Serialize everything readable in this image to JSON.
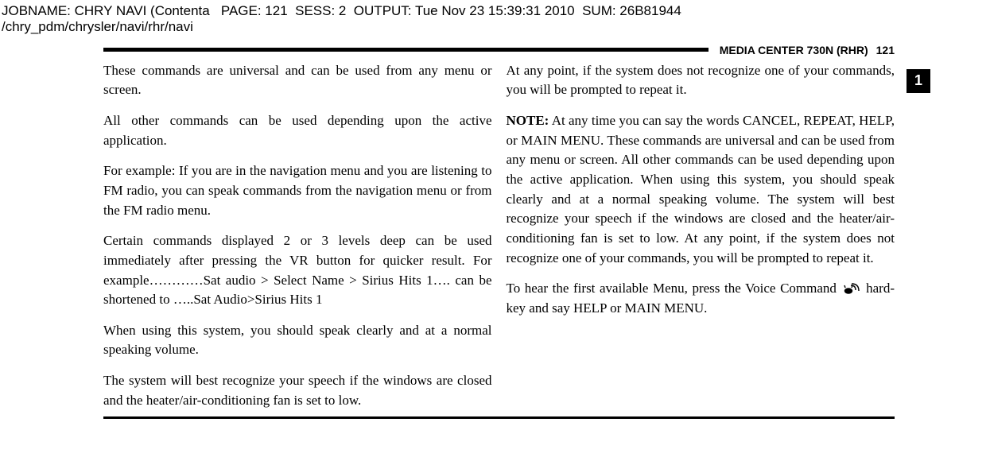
{
  "debug": {
    "line1": "JOBNAME: CHRY NAVI (Contenta   PAGE: 121  SESS: 2  OUTPUT: Tue Nov 23 15:39:31 2010  SUM: 26B81944",
    "line2": "/chry_pdm/chrysler/navi/rhr/navi"
  },
  "header": {
    "title": "MEDIA CENTER 730N (RHR)",
    "page": "121"
  },
  "section_tab": "1",
  "left": {
    "p1": "These commands are universal and can be used from any menu or screen.",
    "p2": "All other commands can be used depending upon the active application.",
    "p3": "For example: If you are in the navigation menu and you are listening to FM radio, you can speak commands from the navigation menu or from the FM radio menu.",
    "p4": "Certain commands displayed 2 or 3 levels deep can be used immediately after pressing the VR button for quicker result. For example…………Sat audio > Select Name > Sirius Hits 1…. can be shortened to …..Sat Audio>Sirius Hits 1",
    "p5": "When using this system, you should speak clearly and at a normal speaking volume.",
    "p6": "The system will best recognize your speech if the windows are closed and the heater/air-conditioning fan is set to low."
  },
  "right": {
    "p1": "At any point, if the system does not recognize one of your commands, you will be prompted to repeat it.",
    "note_label": "NOTE:",
    "p2": " At any time you can say the words CANCEL, REPEAT, HELP, or MAIN MENU. These commands are universal and can be used from any menu or screen. All other commands can be used depending upon the active application. When using this system, you should speak clearly and at a normal speaking volume. The system will best recognize your speech if the windows are closed and the heater/air-conditioning fan is set to low. At any point, if the system does not recognize one of your commands, you will be prompted to repeat it.",
    "p3a": "To hear the first available Menu, press the Voice Command ",
    "p3b": " hard-key and say HELP or MAIN MENU."
  }
}
